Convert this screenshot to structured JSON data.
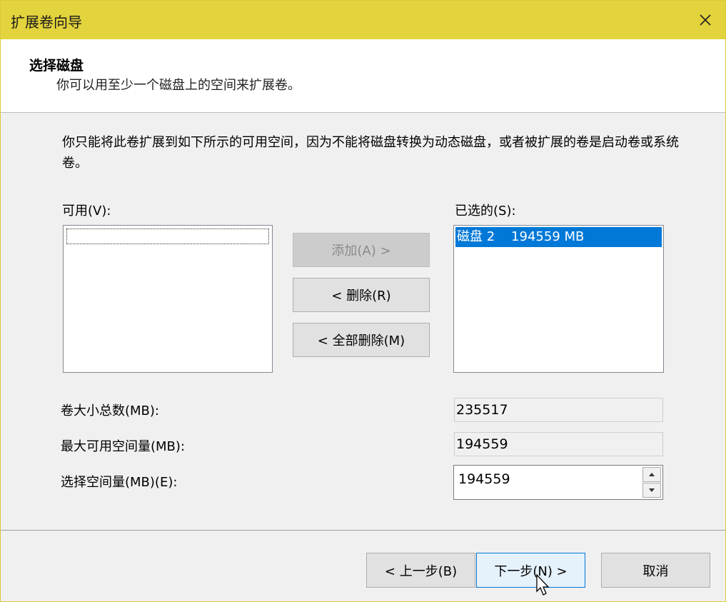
{
  "window": {
    "title": "扩展卷向导"
  },
  "header": {
    "title": "选择磁盘",
    "subtitle": "你可以用至少一个磁盘上的空间来扩展卷。"
  },
  "description": "你只能将此卷扩展到如下所示的可用空间，因为不能将磁盘转换为动态磁盘，或者被扩展的卷是启动卷或系统卷。",
  "available": {
    "label": "可用(V):",
    "items": []
  },
  "selected": {
    "label": "已选的(S):",
    "items": [
      {
        "text": "磁盘 2    194559 MB"
      }
    ]
  },
  "buttons": {
    "add": "添加(A) >",
    "remove": "< 删除(R)",
    "remove_all": "< 全部删除(M)",
    "back": "< 上一步(B)",
    "next": "下一步(N) >",
    "cancel": "取消"
  },
  "fields": {
    "total_label": "卷大小总数(MB):",
    "total_value": "235517",
    "max_label": "最大可用空间量(MB):",
    "max_value": "194559",
    "select_label": "选择空间量(MB)(E):",
    "select_value": "194559"
  },
  "colors": {
    "titlebar": "#e3d33c",
    "selection": "#0078d7"
  }
}
